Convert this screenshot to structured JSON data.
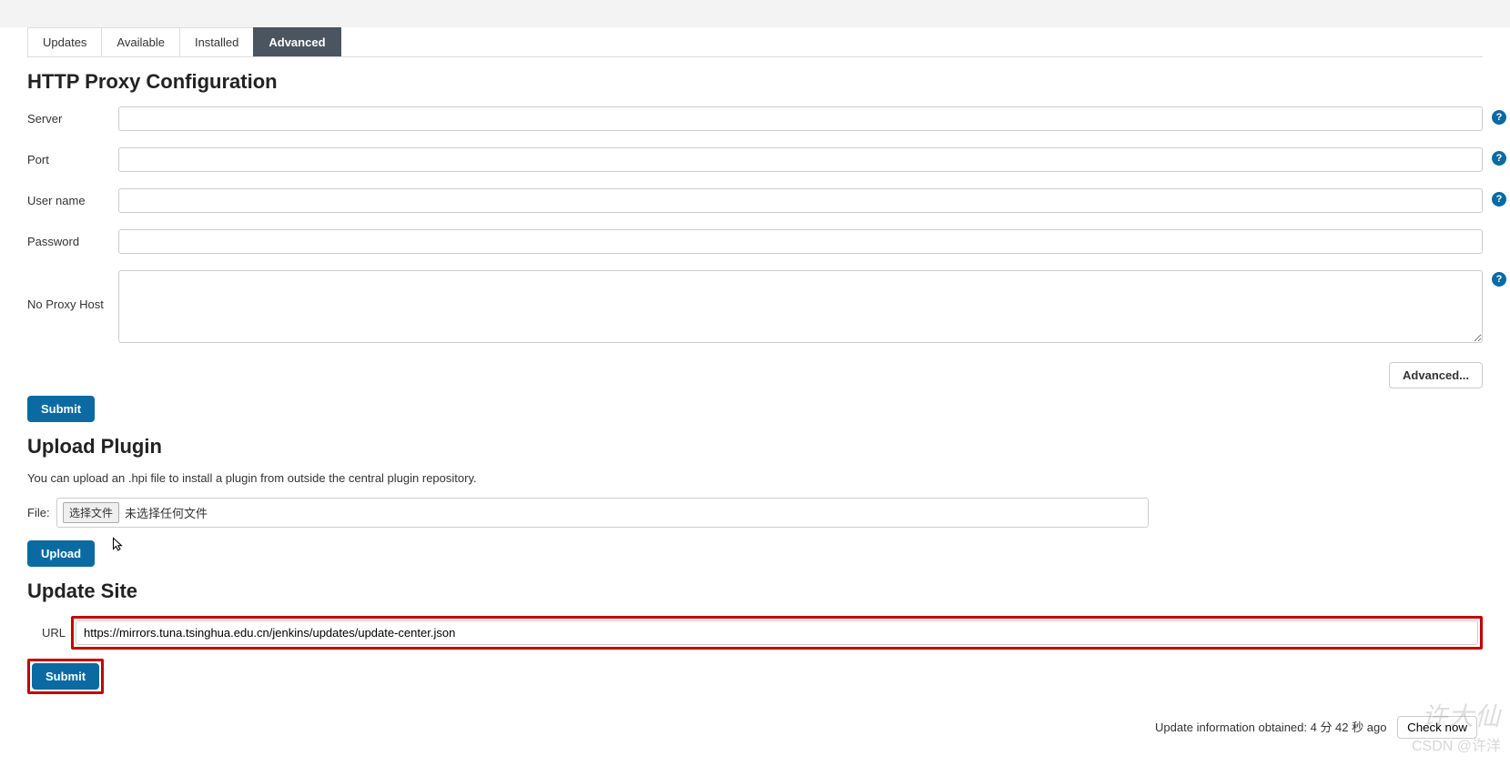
{
  "tabs": {
    "updates": "Updates",
    "available": "Available",
    "installed": "Installed",
    "advanced": "Advanced"
  },
  "proxy": {
    "title": "HTTP Proxy Configuration",
    "server_label": "Server",
    "server_value": "",
    "port_label": "Port",
    "port_value": "",
    "username_label": "User name",
    "username_value": "",
    "password_label": "Password",
    "password_value": "",
    "noproxy_label": "No Proxy Host",
    "noproxy_value": "",
    "advanced_btn": "Advanced...",
    "submit_btn": "Submit"
  },
  "upload": {
    "title": "Upload Plugin",
    "desc": "You can upload an .hpi file to install a plugin from outside the central plugin repository.",
    "file_label": "File:",
    "choose_label": "选择文件",
    "no_file": "未选择任何文件",
    "upload_btn": "Upload"
  },
  "update_site": {
    "title": "Update Site",
    "url_label": "URL",
    "url_value": "https://mirrors.tuna.tsinghua.edu.cn/jenkins/updates/update-center.json",
    "submit_btn": "Submit"
  },
  "footer": {
    "info": "Update information obtained: 4 分 42 秒 ago",
    "check_now": "Check now"
  },
  "watermark": {
    "line1": "许大仙",
    "line2": "CSDN @许洋"
  }
}
